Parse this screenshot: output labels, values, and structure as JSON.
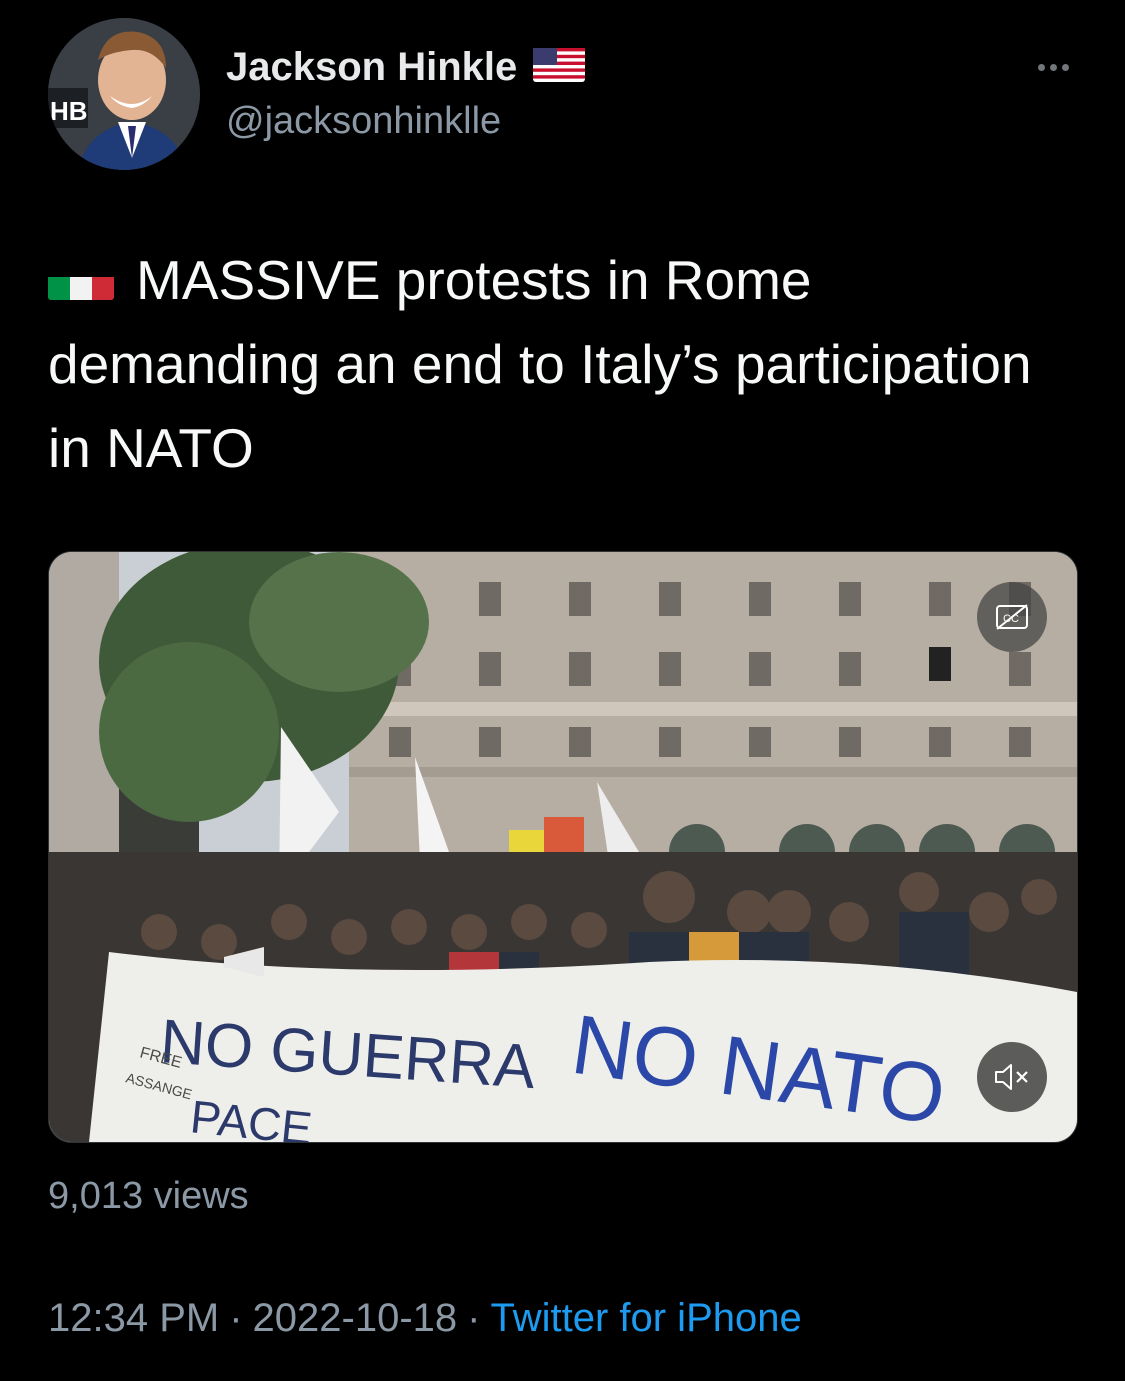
{
  "author": {
    "display_name": "Jackson Hinkle",
    "handle": "@jacksonhinklle",
    "avatar_backdrop_text": "HB"
  },
  "header": {
    "more_icon": "more-horizontal-icon"
  },
  "tweet": {
    "text": "MASSIVE protests in Rome demanding an end to Italy’s participation in NATO"
  },
  "media": {
    "banner_text_main": "NO GUERRA",
    "banner_text_nato": "NO NATO",
    "banner_text_small_1": "FREE",
    "banner_text_small_2": "ASSANGE",
    "banner_text_pace": "PACE",
    "cc_icon": "closed-captions-icon",
    "mute_icon": "volume-muted-icon"
  },
  "stats": {
    "views": "9,013 views"
  },
  "meta": {
    "time": "12:34 PM",
    "separator": "·",
    "date": "2022-10-18",
    "source": "Twitter for iPhone"
  },
  "colors": {
    "background": "#000000",
    "secondary_text": "#8b98a5",
    "link": "#1d9bf0"
  }
}
